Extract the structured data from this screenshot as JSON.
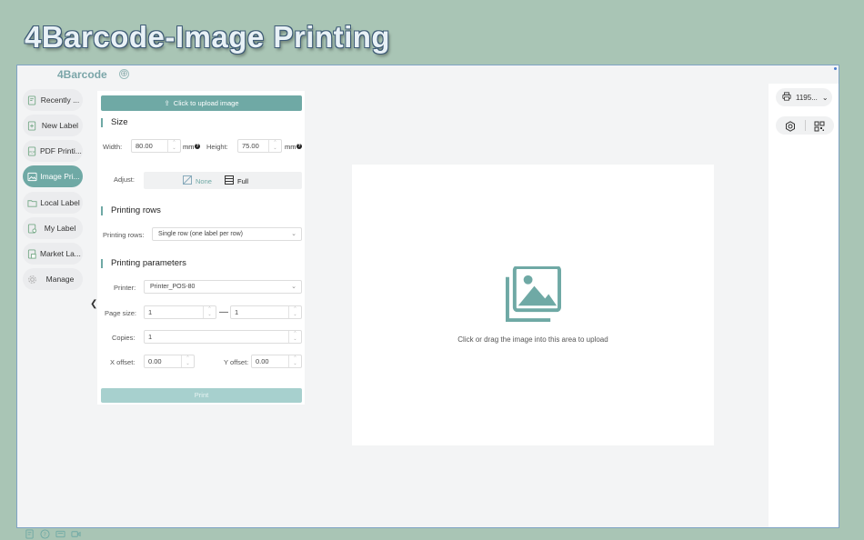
{
  "banner": {
    "title": "4Barcode-Image Printing"
  },
  "app": {
    "name": "4Barcode",
    "add_tab": "⊕"
  },
  "sidebar": {
    "items": [
      {
        "label": "Recently ...",
        "icon": "document-clock-icon"
      },
      {
        "label": "New Label",
        "icon": "document-add-icon"
      },
      {
        "label": "PDF Printi...",
        "icon": "pdf-icon"
      },
      {
        "label": "Image Pri...",
        "icon": "image-icon",
        "active": true
      },
      {
        "label": "Local Label",
        "icon": "folder-icon"
      },
      {
        "label": "My Label",
        "icon": "label-icon"
      },
      {
        "label": "Market La...",
        "icon": "market-icon"
      },
      {
        "label": "Manage",
        "icon": "gear-icon"
      }
    ],
    "bottom_icons": [
      "notes-icon",
      "help-icon",
      "card-icon",
      "video-icon"
    ]
  },
  "panel": {
    "upload_label": "Click to upload image",
    "size": {
      "title": "Size",
      "width_label": "Width:",
      "width_value": "80.00",
      "height_label": "Height:",
      "height_value": "75.00",
      "unit": "mm"
    },
    "adjust": {
      "label": "Adjust:",
      "options": [
        {
          "label": "None",
          "selected": false
        },
        {
          "label": "Full",
          "selected": true
        }
      ]
    },
    "printing_rows": {
      "title": "Printing rows",
      "label": "Printing rows:",
      "value": "Single row (one label per row)"
    },
    "printing_params": {
      "title": "Printing parameters",
      "printer_label": "Printer:",
      "printer_value": "Printer_POS-80",
      "page_size_label": "Page size:",
      "page_from": "1",
      "page_dash": "—",
      "page_to": "1",
      "copies_label": "Copies:",
      "copies_value": "1",
      "x_offset_label": "X offset:",
      "x_offset_value": "0.00",
      "y_offset_label": "Y offset:",
      "y_offset_value": "0.00"
    },
    "print_label": "Print"
  },
  "canvas": {
    "hint": "Click or drag the image into this area to upload"
  },
  "right_panel": {
    "printer_name": "1195..."
  },
  "colors": {
    "accent": "#6fa9a5",
    "accent_light": "#a7d0ce",
    "background": "#a9c5b5"
  }
}
